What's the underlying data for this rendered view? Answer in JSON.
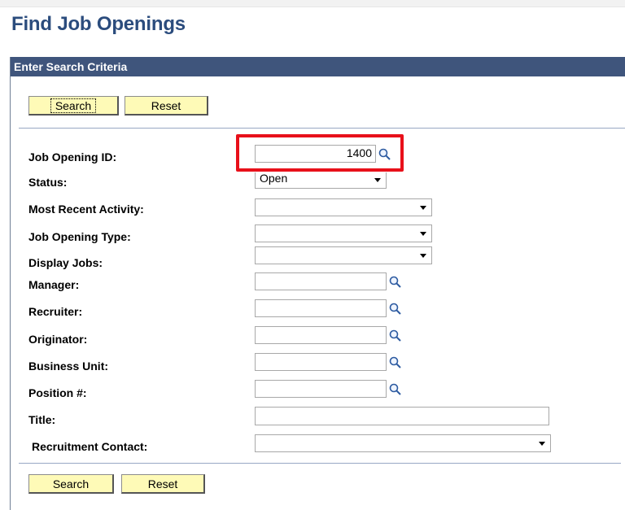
{
  "page": {
    "title": "Find Job Openings"
  },
  "panel": {
    "header": "Enter Search Criteria"
  },
  "buttons": {
    "search": "Search",
    "reset": "Reset"
  },
  "fields": {
    "job_opening_id": {
      "label": "Job Opening ID:",
      "value": "1400",
      "icon": "search-icon"
    },
    "status": {
      "label": "Status:",
      "value": "Open"
    },
    "most_recent_activity": {
      "label": "Most Recent Activity:",
      "value": ""
    },
    "job_opening_type": {
      "label": "Job Opening Type:",
      "value": ""
    },
    "display_jobs": {
      "label": "Display Jobs:",
      "value": ""
    },
    "manager": {
      "label": "Manager:",
      "value": "",
      "icon": "search-icon"
    },
    "recruiter": {
      "label": "Recruiter:",
      "value": "",
      "icon": "search-icon"
    },
    "originator": {
      "label": "Originator:",
      "value": "",
      "icon": "search-icon"
    },
    "business_unit": {
      "label": "Business Unit:",
      "value": "",
      "icon": "search-icon"
    },
    "position_num": {
      "label": "Position #:",
      "value": "",
      "icon": "search-icon"
    },
    "title": {
      "label": "Title:",
      "value": ""
    },
    "recruitment_contact": {
      "label": "Recruitment Contact:",
      "value": ""
    }
  },
  "colors": {
    "title": "#2b4c7d",
    "header_bg": "#3f557c",
    "button_bg": "#fefab7",
    "highlight": "#e8101a"
  }
}
